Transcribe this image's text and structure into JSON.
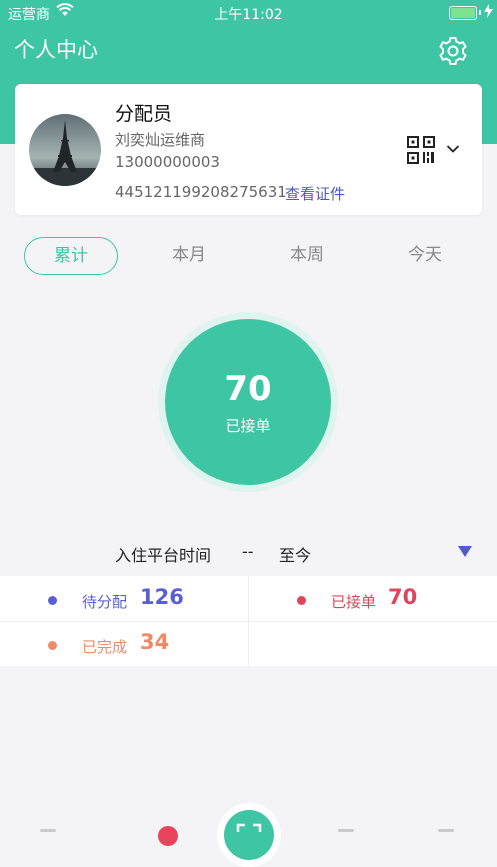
{
  "status_bar": {
    "carrier": "运营商",
    "time": "上午11:02"
  },
  "header": {
    "title": "个人中心",
    "settings_icon": "gear-icon"
  },
  "profile": {
    "role": "分配员",
    "company": "刘奕灿运维商",
    "phone": "13000000003",
    "id_number": "445121199208275631",
    "view_cert_link": "查看证件",
    "qr_icon": "qr-code-icon",
    "expand_icon": "chevron-down-icon"
  },
  "tabs": [
    {
      "label": "累计",
      "active": true
    },
    {
      "label": "本月",
      "active": false
    },
    {
      "label": "本周",
      "active": false
    },
    {
      "label": "今天",
      "active": false
    }
  ],
  "summary": {
    "value": "70",
    "label": "已接单"
  },
  "date_range": {
    "label": "入住平台时间",
    "separator": "--",
    "end": "至今",
    "dropdown_icon": "triangle-down-icon"
  },
  "stats": [
    {
      "label": "待分配",
      "value": "126",
      "color": "#5a5fd3"
    },
    {
      "label": "已接单",
      "value": "70",
      "color": "#e0455c"
    },
    {
      "label": "已完成",
      "value": "34",
      "color": "#ef8a64"
    }
  ],
  "colors": {
    "accent": "#3ec5a3",
    "link": "#4a58c9",
    "badge": "#e8455b"
  }
}
